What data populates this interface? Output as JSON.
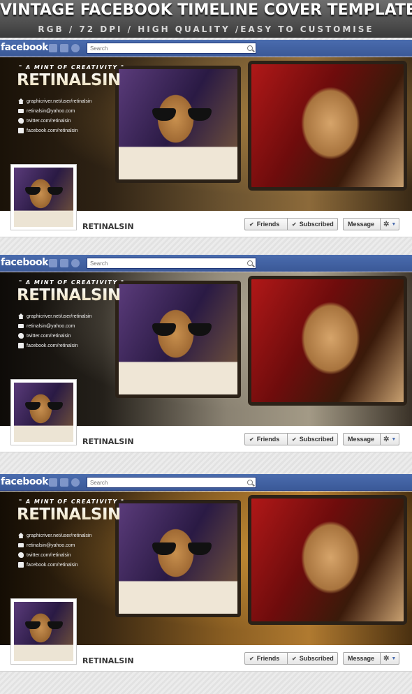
{
  "header": {
    "title": "VINTAGE FACEBOOK TIMELINE COVER TEMPLATE",
    "subtitle": "RGB / 72 DPI / HIGH QUALITY /EASY TO CUSTOMISE"
  },
  "facebook": {
    "logo": "facebook",
    "search_placeholder": "Search"
  },
  "cover": {
    "tagline": "\" A MINT OF CREATIVITY \"",
    "brand": "RETINALSIN",
    "contacts": [
      {
        "icon": "home-icon",
        "text": "graphicriver.net/user/retinalsin"
      },
      {
        "icon": "mail-icon",
        "text": "retinalsin@yahoo.com"
      },
      {
        "icon": "twitter-icon",
        "text": "twitter.com/retinalsin"
      },
      {
        "icon": "facebook-icon",
        "text": "facebook.com/retinalsin"
      }
    ]
  },
  "profile": {
    "name": "RETINALSIN",
    "friends_label": "Friends",
    "subscribed_label": "Subscribed",
    "message_label": "Message"
  },
  "colors": {
    "facebook_blue": "#3b5998",
    "header_dark": "#3a3a3a"
  }
}
